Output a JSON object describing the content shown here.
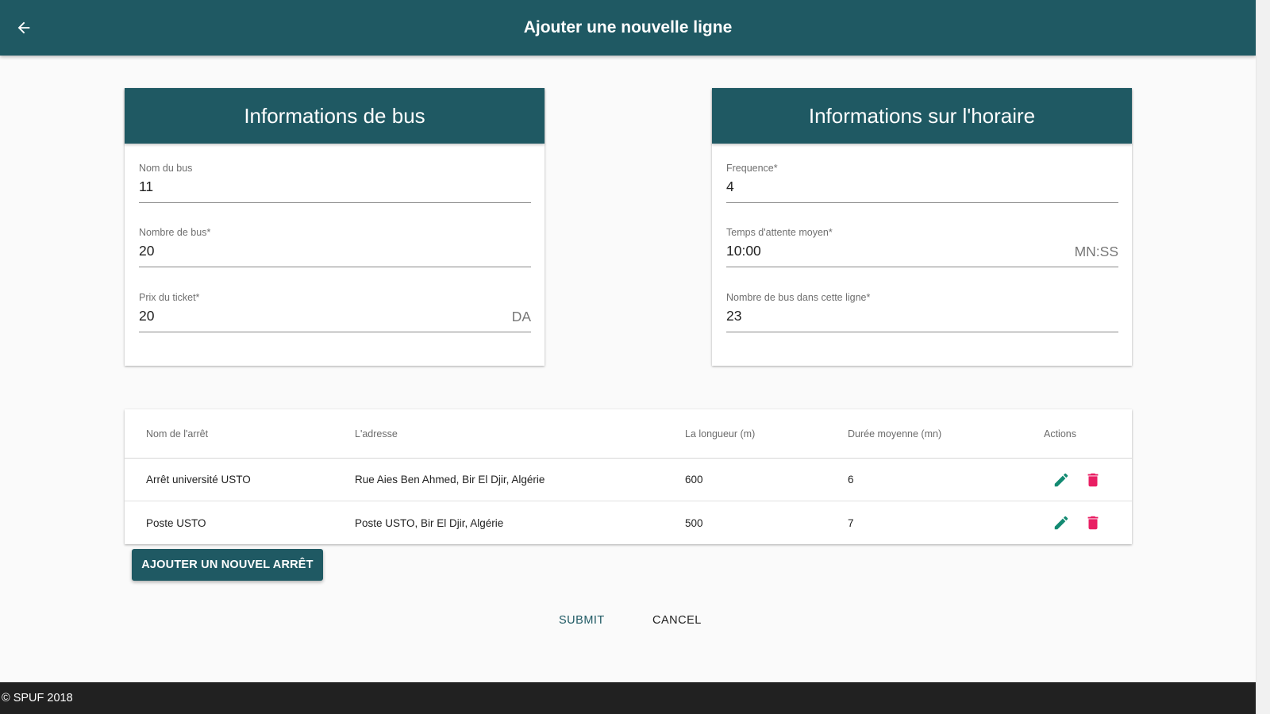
{
  "toolbar": {
    "title": "Ajouter une nouvelle ligne",
    "back_icon": "arrow-left-icon"
  },
  "bus_card": {
    "title": "Informations de bus",
    "fields": [
      {
        "label": "Nom du bus",
        "value": "11",
        "suffix": ""
      },
      {
        "label": "Nombre de bus*",
        "value": "20",
        "suffix": ""
      },
      {
        "label": "Prix du ticket*",
        "value": "20",
        "suffix": "DA"
      }
    ]
  },
  "schedule_card": {
    "title": "Informations sur l'horaire",
    "fields": [
      {
        "label": "Frequence*",
        "value": "4",
        "suffix": ""
      },
      {
        "label": "Temps d'attente moyen*",
        "value": "10:00",
        "suffix": "MN:SS"
      },
      {
        "label": "Nombre de bus dans cette ligne*",
        "value": "23",
        "suffix": ""
      }
    ]
  },
  "stops_table": {
    "columns": [
      "Nom de l'arrêt",
      "L'adresse",
      "La longueur (m)",
      "Durée moyenne (mn)",
      "Actions"
    ],
    "rows": [
      {
        "name": "Arrêt université USTO",
        "address": "Rue Aies Ben Ahmed, Bir El Djir, Algérie",
        "length": "600",
        "duration": "6"
      },
      {
        "name": "Poste USTO",
        "address": "Poste USTO, Bir El Djir, Algérie",
        "length": "500",
        "duration": "7"
      }
    ],
    "edit_icon": "pencil-icon",
    "delete_icon": "trash-icon"
  },
  "buttons": {
    "add_stop": "AJOUTER UN NOUVEL ARRÊT",
    "submit": "SUBMIT",
    "cancel": "CANCEL"
  },
  "footer": {
    "text": "© SPUF 2018"
  },
  "colors": {
    "primary": "#1f5963",
    "edit": "#138a72",
    "delete": "#e91e63",
    "footer": "#212121"
  }
}
